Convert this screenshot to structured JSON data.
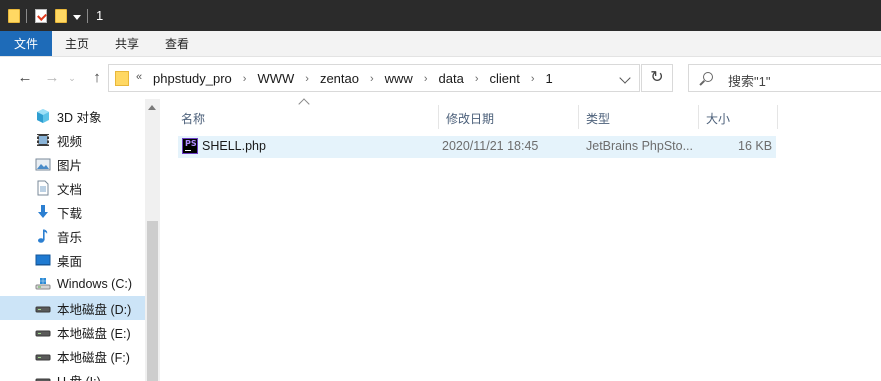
{
  "window": {
    "title": "1"
  },
  "ribbon": {
    "tabs": [
      "文件",
      "主页",
      "共享",
      "查看"
    ]
  },
  "nav": {
    "back": "←",
    "forward": "→",
    "up": "↑",
    "refresh": "↻"
  },
  "address": {
    "prefix": "«",
    "breadcrumbs": [
      "phpstudy_pro",
      "WWW",
      "zentao",
      "www",
      "data",
      "client",
      "1"
    ]
  },
  "search": {
    "placeholder": "搜索\"1\""
  },
  "sidebar": {
    "items": [
      {
        "label": "3D 对象",
        "icon": "3d-objects-icon"
      },
      {
        "label": "视频",
        "icon": "video-icon"
      },
      {
        "label": "图片",
        "icon": "pictures-icon"
      },
      {
        "label": "文档",
        "icon": "documents-icon"
      },
      {
        "label": "下载",
        "icon": "downloads-icon"
      },
      {
        "label": "音乐",
        "icon": "music-icon"
      },
      {
        "label": "桌面",
        "icon": "desktop-icon"
      },
      {
        "label": "Windows (C:)",
        "icon": "system-drive-icon"
      },
      {
        "label": "本地磁盘 (D:)",
        "icon": "drive-icon",
        "selected": true
      },
      {
        "label": "本地磁盘 (E:)",
        "icon": "drive-icon"
      },
      {
        "label": "本地磁盘 (F:)",
        "icon": "drive-icon"
      },
      {
        "label": "U 盘 (I:)",
        "icon": "usb-drive-icon"
      }
    ]
  },
  "columns": {
    "name": "名称",
    "modified": "修改日期",
    "type": "类型",
    "size": "大小"
  },
  "files": [
    {
      "name": "SHELL.php",
      "modified": "2020/11/21 18:45",
      "type": "JetBrains PhpSto...",
      "size": "16 KB",
      "icon": "phpstorm-file-icon"
    }
  ],
  "colors": {
    "accent": "#1e6bb8",
    "selection": "#cce4f7",
    "hover_row": "#e5f3fb",
    "titlebar": "#2b2b2b"
  }
}
